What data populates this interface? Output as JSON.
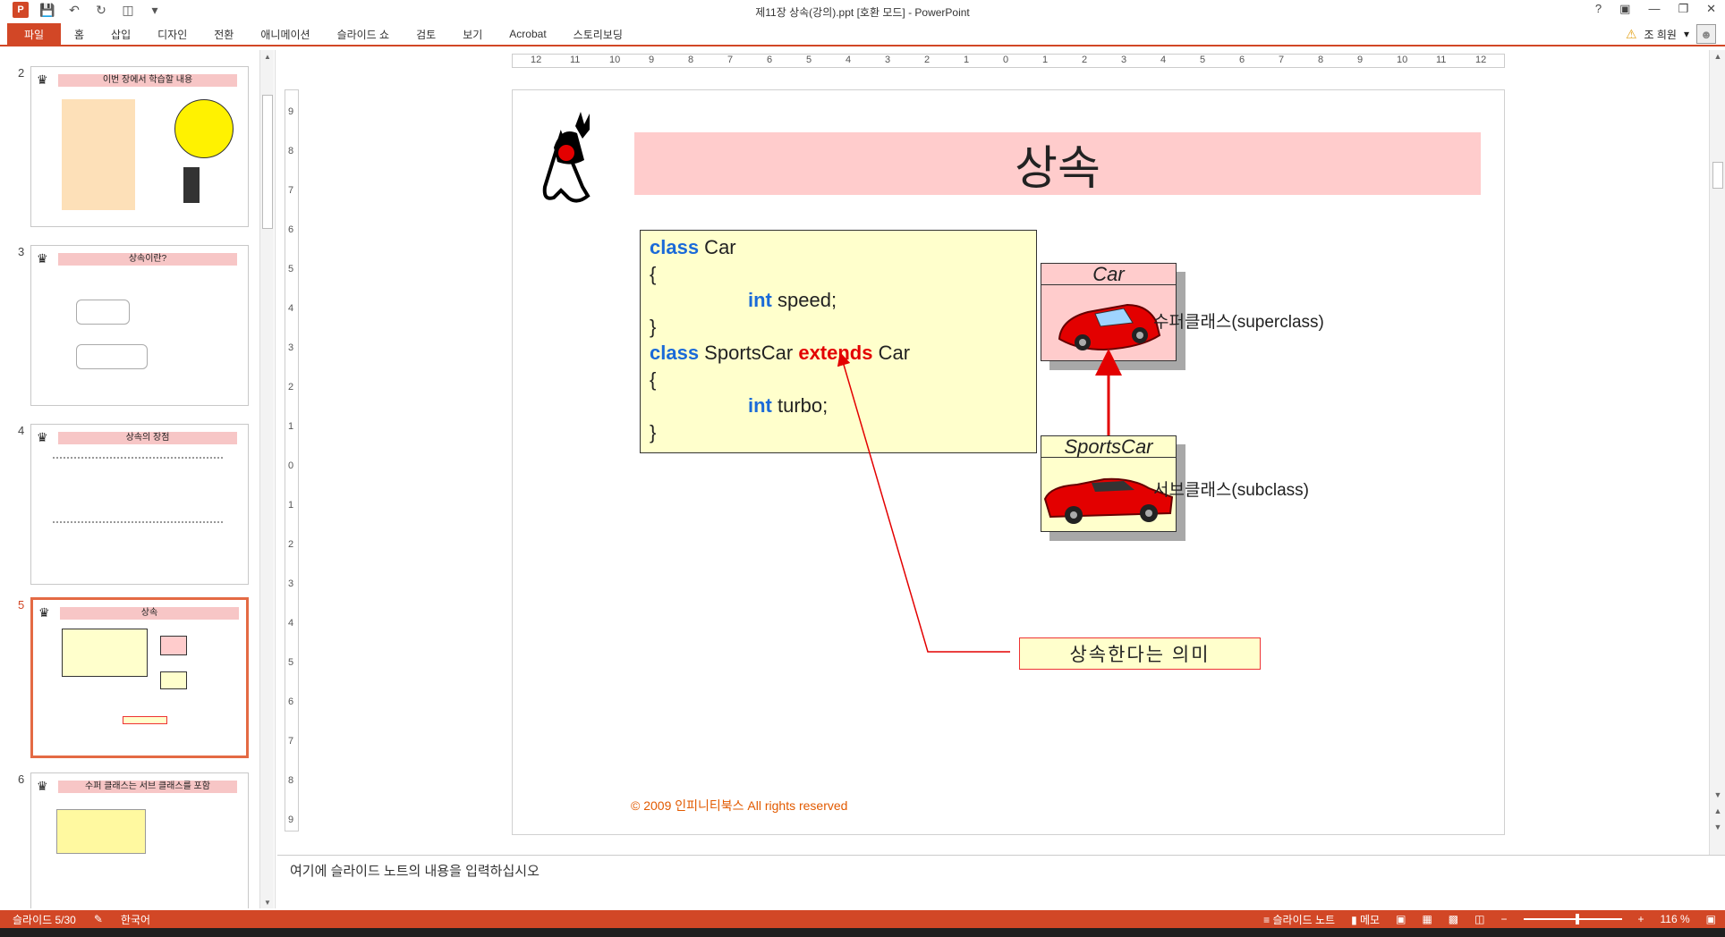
{
  "window": {
    "title": "제11장 상속(강의).ppt [호환 모드] - PowerPoint"
  },
  "qat": {
    "app_icon": "P"
  },
  "ribbon": {
    "file_tab": "파일",
    "tabs": [
      "홈",
      "삽입",
      "디자인",
      "전환",
      "애니메이션",
      "슬라이드 쇼",
      "검토",
      "보기",
      "Acrobat",
      "스토리보딩"
    ]
  },
  "user": {
    "name": "조 희원"
  },
  "thumbnails": [
    {
      "num": "2",
      "title": "이번 장에서 학습할 내용"
    },
    {
      "num": "3",
      "title": "상속이란?"
    },
    {
      "num": "4",
      "title": "상속의 장점"
    },
    {
      "num": "5",
      "title": "상속"
    },
    {
      "num": "6",
      "title": "수퍼 클래스는 서브 클래스를 포함"
    }
  ],
  "ruler": {
    "horizontal": [
      "12",
      "11",
      "10",
      "9",
      "8",
      "7",
      "6",
      "5",
      "4",
      "3",
      "2",
      "1",
      "0",
      "1",
      "2",
      "3",
      "4",
      "5",
      "6",
      "7",
      "8",
      "9",
      "10",
      "11",
      "12"
    ],
    "vertical": [
      "9",
      "8",
      "7",
      "6",
      "5",
      "4",
      "3",
      "2",
      "1",
      "0",
      "1",
      "2",
      "3",
      "4",
      "5",
      "6",
      "7",
      "8",
      "9"
    ]
  },
  "slide": {
    "title": "상속",
    "code": {
      "line1_kw": "class",
      "line1_rest": " Car",
      "line2": "{",
      "line3_kw": "int",
      "line3_rest": " speed;",
      "line4": "}",
      "line5_kw": "class",
      "line5_mid": " SportsCar ",
      "line5_ext": "extends",
      "line5_rest": " Car",
      "line6": "{",
      "line7_kw": "int",
      "line7_rest": " turbo;",
      "line8": "}"
    },
    "super_class_name": "Car",
    "sub_class_name": "SportsCar",
    "super_label": "수퍼클래스(superclass)",
    "sub_label": "서브클래스(subclass)",
    "meaning": "상속한다는 의미",
    "copyright": "© 2009 인피니티북스  All rights reserved",
    "colors": {
      "title_bg": "#ffcccc",
      "code_bg": "#ffffcc",
      "keyword": "#1a6ad8",
      "extends": "#e30000"
    }
  },
  "notes": {
    "placeholder": "여기에 슬라이드 노트의 내용을 입력하십시오"
  },
  "status": {
    "slide_info": "슬라이드 5/30",
    "language": "한국어",
    "notes_btn": "슬라이드 노트",
    "memo_btn": "메모",
    "zoom": "116 %"
  }
}
